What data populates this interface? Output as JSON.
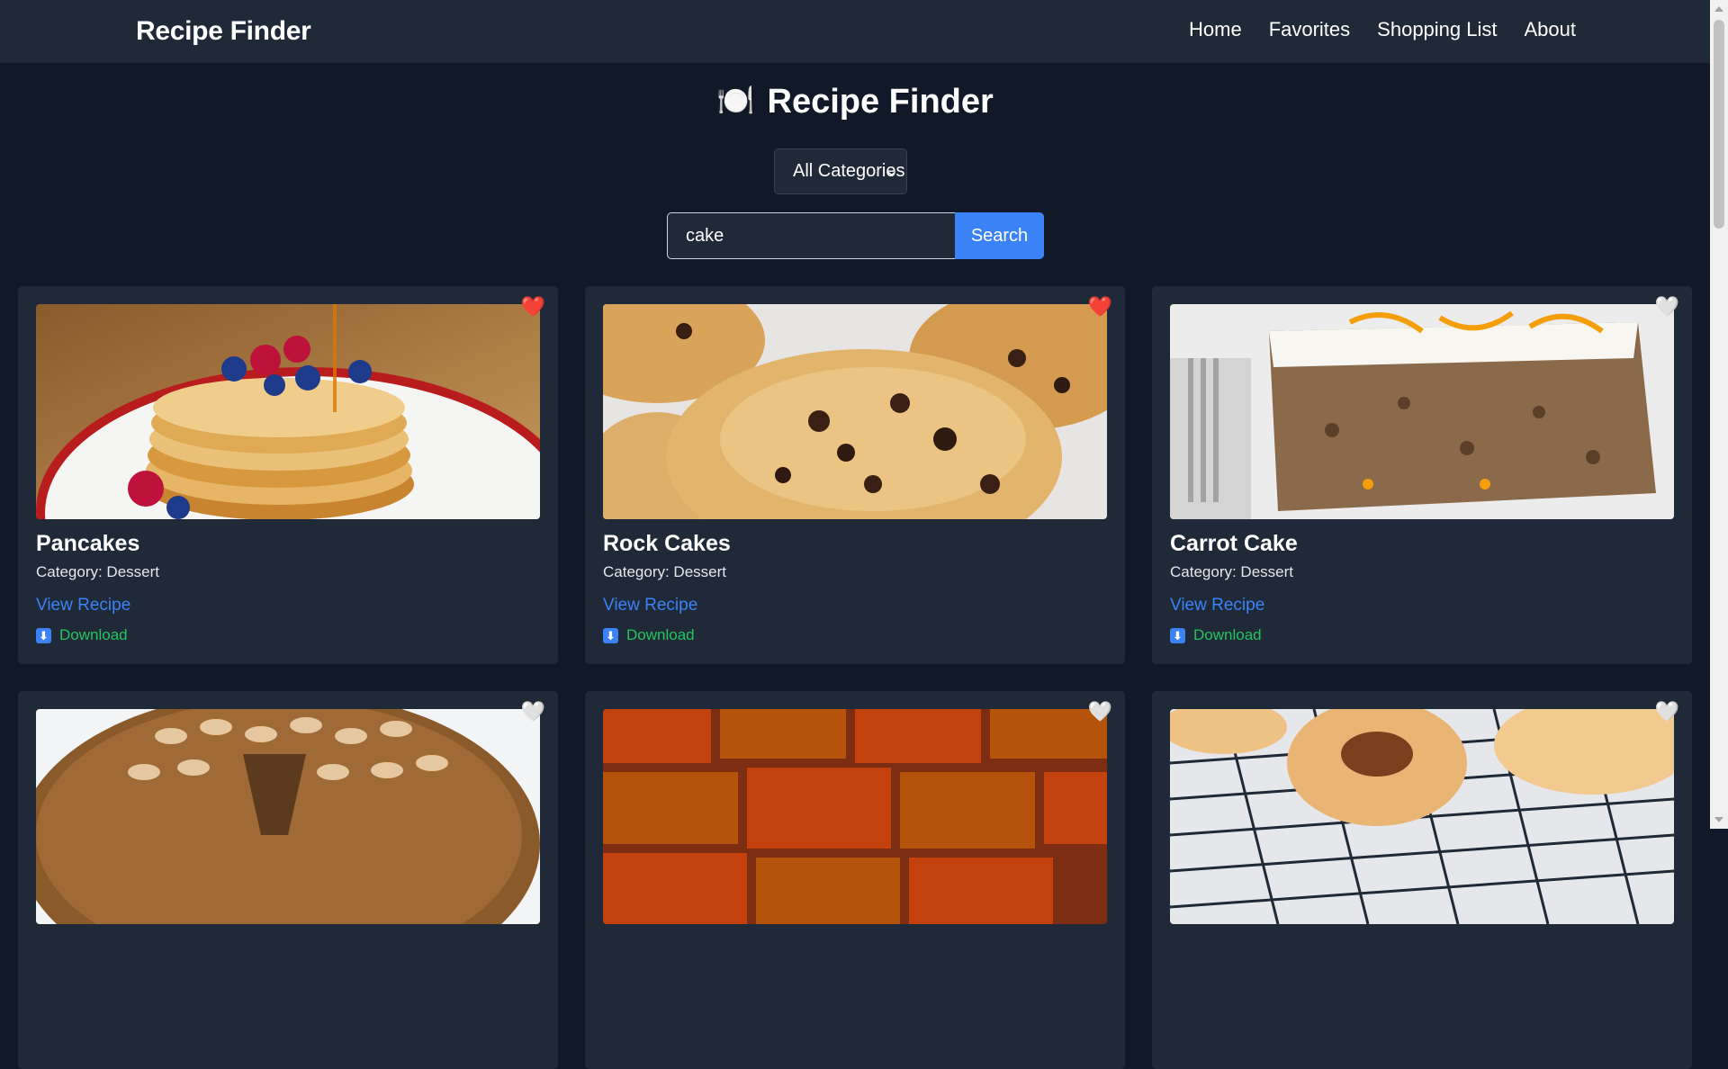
{
  "navbar": {
    "brand": "Recipe Finder",
    "links": [
      "Home",
      "Favorites",
      "Shopping List",
      "About"
    ]
  },
  "page": {
    "heading": "Recipe Finder",
    "heading_icon": "🍽️"
  },
  "filter": {
    "category_selected": "All Categories"
  },
  "search": {
    "value": "cake",
    "button_label": "Search"
  },
  "recipes": [
    {
      "title": "Pancakes",
      "category": "Category: Dessert",
      "view": "View Recipe",
      "download": "Download",
      "favorited": true,
      "image": "pancakes-photo"
    },
    {
      "title": "Rock Cakes",
      "category": "Category: Dessert",
      "view": "View Recipe",
      "download": "Download",
      "favorited": true,
      "image": "rock-cakes-photo"
    },
    {
      "title": "Carrot Cake",
      "category": "Category: Dessert",
      "view": "View Recipe",
      "download": "Download",
      "favorited": false,
      "image": "carrot-cake-photo"
    },
    {
      "image": "almond-cake-photo",
      "favorited": false
    },
    {
      "image": "brownies-photo",
      "favorited": false
    },
    {
      "image": "pastry-photo",
      "favorited": false
    }
  ],
  "colors": {
    "background": "#111827",
    "surface": "#1f2937",
    "accent": "#3b82f6",
    "download": "#22c55e",
    "heart_filled": "#ec4899",
    "heart_empty": "#ddd6fe"
  },
  "icons": {
    "heart_filled": "❤️",
    "heart_empty": "🤍",
    "download": "⬇"
  }
}
